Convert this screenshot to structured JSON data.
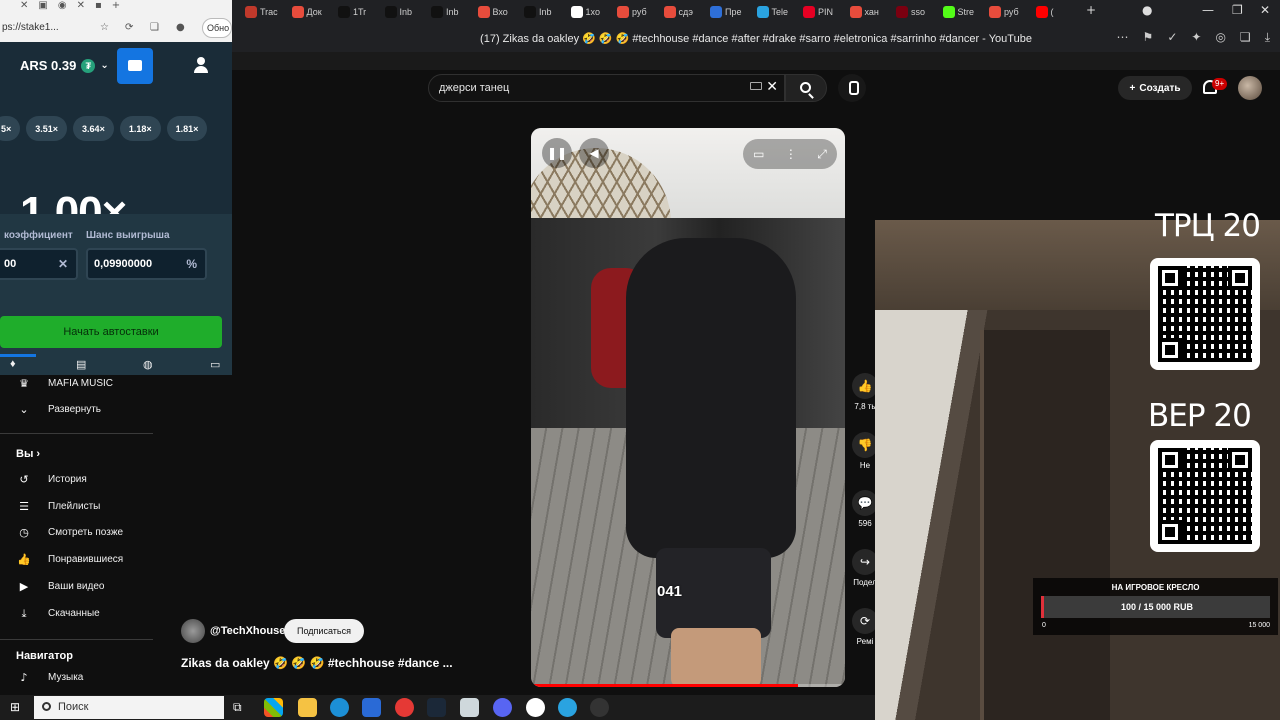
{
  "browser": {
    "tabs": [
      {
        "label": "Trac",
        "color": "#c0392b"
      },
      {
        "label": "Док",
        "color": "#e74c3c"
      },
      {
        "label": "1Tr",
        "color": "#111111"
      },
      {
        "label": "Inb",
        "color": "#111111"
      },
      {
        "label": "Inb",
        "color": "#111111"
      },
      {
        "label": "Вхо",
        "color": "#e74c3c"
      },
      {
        "label": "Inb",
        "color": "#111111"
      },
      {
        "label": "1xo",
        "color": "#ffffff"
      },
      {
        "label": "руб",
        "color": "#e74c3c"
      },
      {
        "label": "сдэ",
        "color": "#e74c3c"
      },
      {
        "label": "Пре",
        "color": "#2e6fd8"
      },
      {
        "label": "Tele",
        "color": "#2aa3e0"
      },
      {
        "label": "PIN",
        "color": "#e60023"
      },
      {
        "label": "хан",
        "color": "#e74c3c"
      },
      {
        "label": "sso",
        "color": "#7a0010"
      },
      {
        "label": "Stre",
        "color": "#53fc18"
      },
      {
        "label": "руб",
        "color": "#e74c3c"
      },
      {
        "label": "(",
        "color": "#ff0000"
      }
    ],
    "page_title": "(17) Zikas da oakley 🤣 🤣 🤣 #techhouse #dance #after #drake #sarro #eletronica #sarrinho #dancer - YouTube"
  },
  "left_browser": {
    "url": "ps://stake1...",
    "button_label": "Обно"
  },
  "stake": {
    "balance": "ARS 0.39",
    "tether_symbol": "₮",
    "recent_multipliers": [
      "5×",
      "3.51×",
      "3.64×",
      "1.18×",
      "1.81×"
    ],
    "multiplier": "1.00×",
    "coef_label": "коэффициент",
    "coef_value": "00",
    "chance_label": "Шанс выигрыша",
    "chance_value": "0,09900000",
    "chance_unit": "%",
    "auto_button": "Начать автоставки",
    "accent": "#1fad2b"
  },
  "youtube": {
    "search_query": "джерси танец",
    "create_label": "Создать",
    "notif_badge": "9+",
    "sidebar": {
      "mafia": "MAFIA MUSIC",
      "expand": "Развернуть",
      "you_title": "Вы",
      "you_chevron": "›",
      "items": [
        {
          "label": "История",
          "icon": "↺"
        },
        {
          "label": "Плейлисты",
          "icon": "☰"
        },
        {
          "label": "Смотреть позже",
          "icon": "◷"
        },
        {
          "label": "Понравившиеся",
          "icon": "👍"
        },
        {
          "label": "Ваши видео",
          "icon": "▶"
        },
        {
          "label": "Скачанные",
          "icon": "⤓"
        }
      ],
      "nav_title": "Навигатор",
      "music": "Музыка"
    },
    "video": {
      "channel": "@TechXhouse",
      "subscribe": "Подписаться",
      "title": "Zikas da oakley 🤣 🤣 🤣 #techhouse #dance ...",
      "overlay_number": "041",
      "progress": 0.85
    },
    "actions": [
      {
        "icon": "👍",
        "label": "7,8 ть"
      },
      {
        "icon": "👎",
        "label": "Не"
      },
      {
        "icon": "💬",
        "label": "596"
      },
      {
        "icon": "↪",
        "label": "Подел"
      },
      {
        "icon": "⟳",
        "label": "Ремі"
      }
    ]
  },
  "stream_overlay": {
    "qr1_label": "ТРЦ 20",
    "qr2_label": "ВЕР 20",
    "goal_title": "НА ИГРОВОЕ КРЕСЛО",
    "goal_value": "100 / 15 000 RUB",
    "goal_min": "0",
    "goal_max": "15 000",
    "goal_progress": 0.007
  },
  "taskbar": {
    "search": "Поиск"
  }
}
